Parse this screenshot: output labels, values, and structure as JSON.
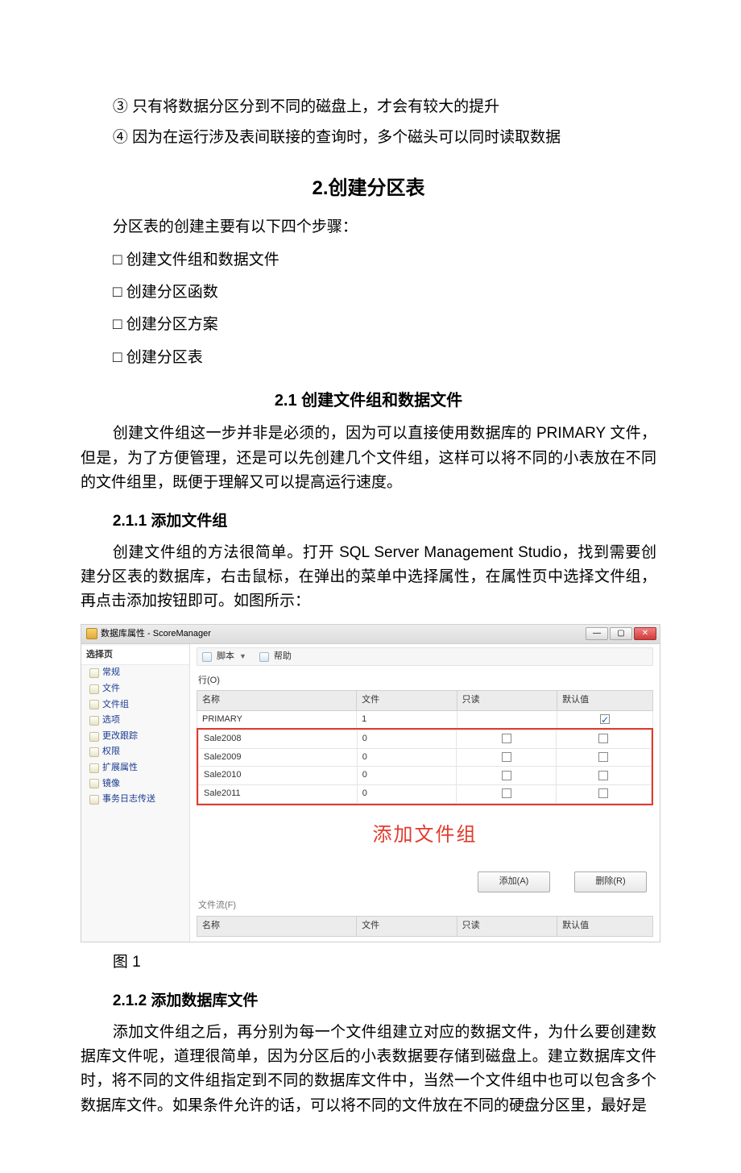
{
  "top_lines": {
    "l3": "③ 只有将数据分区分到不同的磁盘上，才会有较大的提升",
    "l4": "④ 因为在运行涉及表间联接的查询时，多个磁头可以同时读取数据"
  },
  "h2": "2.创建分区表",
  "p_steps_intro": "分区表的创建主要有以下四个步骤：",
  "steps": {
    "s1": "创建文件组和数据文件",
    "s2": "创建分区函数",
    "s3": "创建分区方案",
    "s4": "创建分区表"
  },
  "h21": "2.1 创建文件组和数据文件",
  "p21": "创建文件组这一步并非是必须的，因为可以直接使用数据库的 PRIMARY 文件，但是，为了方便管理，还是可以先创建几个文件组，这样可以将不同的小表放在不同的文件组里，既便于理解又可以提高运行速度。",
  "h211": "2.1.1 添加文件组",
  "p211": "创建文件组的方法很简单。打开 SQL Server Management Studio，找到需要创建分区表的数据库，右击鼠标，在弹出的菜单中选择属性，在属性页中选择文件组，再点击添加按钮即可。如图所示：",
  "fig_caption": "图 1",
  "h212": "2.1.2 添加数据库文件",
  "p212": "添加文件组之后，再分别为每一个文件组建立对应的数据文件，为什么要创建数据库文件呢，道理很简单，因为分区后的小表数据要存储到磁盘上。建立数据库文件时，将不同的文件组指定到不同的数据库文件中，当然一个文件组中也可以包含多个数据库文件。如果条件允许的话，可以将不同的文件放在不同的硬盘分区里，最好是",
  "dlg": {
    "title": "数据库属性 - ScoreManager",
    "select_page": "选择页",
    "sidebar": {
      "s0": "常规",
      "s1": "文件",
      "s2": "文件组",
      "s3": "选项",
      "s4": "更改跟踪",
      "s5": "权限",
      "s6": "扩展属性",
      "s7": "镜像",
      "s8": "事务日志传送"
    },
    "toolbar": {
      "script": "脚本",
      "help": "帮助"
    },
    "section_rows": "行(O)",
    "th": {
      "name": "名称",
      "files": "文件",
      "readonly": "只读",
      "default": "默认值"
    },
    "rows": {
      "r0": {
        "name": "PRIMARY",
        "files": "1"
      },
      "r1": {
        "name": "Sale2008",
        "files": "0"
      },
      "r2": {
        "name": "Sale2009",
        "files": "0"
      },
      "r3": {
        "name": "Sale2010",
        "files": "0"
      },
      "r4": {
        "name": "Sale2011",
        "files": "0"
      }
    },
    "callout": "添加文件组",
    "btn_add": "添加(A)",
    "btn_del": "删除(R)",
    "section_filestream": "文件流(F)",
    "th2": {
      "name": "名称",
      "files": "文件",
      "readonly": "只读",
      "default": "默认值"
    },
    "winbtns": {
      "min": "—",
      "max": "▢",
      "close": "✕"
    }
  }
}
